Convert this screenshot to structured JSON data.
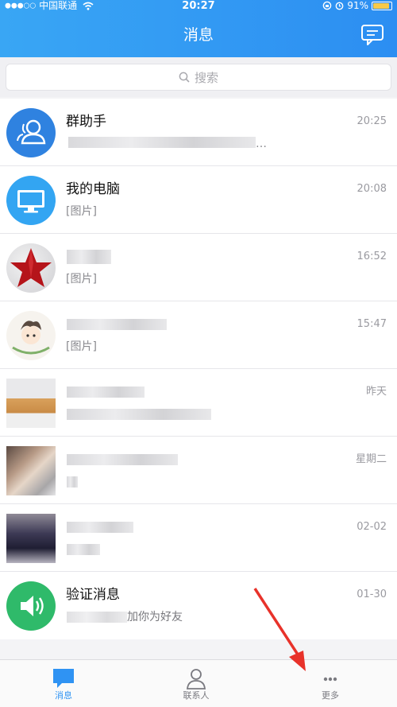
{
  "status_bar": {
    "carrier": "中国联通",
    "time": "20:27",
    "battery": "91%",
    "battery_level": 0.91
  },
  "header": {
    "title": "消息"
  },
  "search": {
    "placeholder": "搜索"
  },
  "conversations": [
    {
      "name": "群助手",
      "preview": "…",
      "time": "20:25",
      "avatar_icon": "group-helper-icon"
    },
    {
      "name": "我的电脑",
      "preview": "[图片]",
      "time": "20:08",
      "avatar_icon": "monitor-icon"
    },
    {
      "name": "",
      "preview": "[图片]",
      "time": "16:52",
      "avatar_icon": "star-avatar"
    },
    {
      "name": "",
      "preview": "[图片]",
      "time": "15:47",
      "avatar_icon": "cartoon-avatar"
    },
    {
      "name": "",
      "preview": "",
      "time": "昨天",
      "avatar_icon": "blurred-avatar"
    },
    {
      "name": "",
      "preview": "",
      "time": "星期二",
      "avatar_icon": "blurred-avatar"
    },
    {
      "name": "",
      "preview": "",
      "time": "02-02",
      "avatar_icon": "blurred-avatar"
    },
    {
      "name": "验证消息",
      "preview": "加你为好友",
      "time": "01-30",
      "avatar_icon": "speaker-icon"
    }
  ],
  "tabbar": [
    {
      "label": "消息",
      "icon": "chat-bubble-icon",
      "active": true
    },
    {
      "label": "联系人",
      "icon": "person-icon",
      "active": false
    },
    {
      "label": "更多",
      "icon": "more-icon",
      "active": false
    }
  ],
  "colors": {
    "accent": "#2f93f3",
    "speaker_green": "#2fba6a",
    "tab_inactive": "#7a7a80"
  }
}
